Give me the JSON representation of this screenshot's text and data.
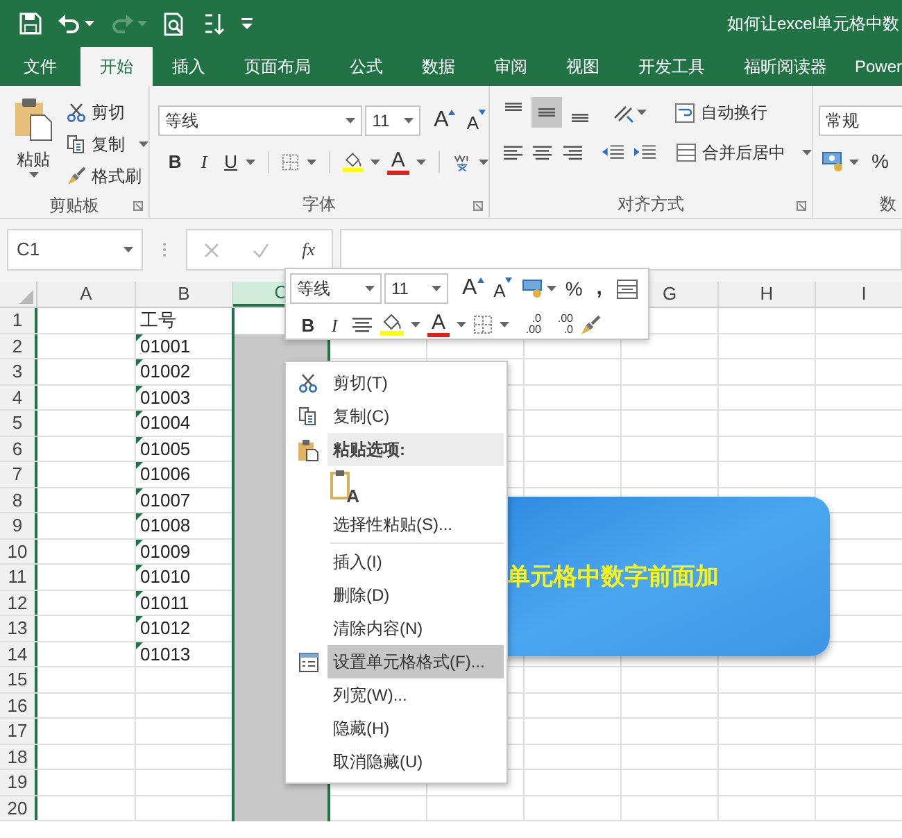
{
  "title_bar": {
    "title": "如何让excel单元格中数"
  },
  "tabs": [
    {
      "label": "文件",
      "selected": false
    },
    {
      "label": "开始",
      "selected": true
    },
    {
      "label": "插入",
      "selected": false
    },
    {
      "label": "页面布局",
      "selected": false
    },
    {
      "label": "公式",
      "selected": false
    },
    {
      "label": "数据",
      "selected": false
    },
    {
      "label": "审阅",
      "selected": false
    },
    {
      "label": "视图",
      "selected": false
    },
    {
      "label": "开发工具",
      "selected": false
    },
    {
      "label": "福昕阅读器",
      "selected": false
    },
    {
      "label": "Power",
      "selected": false
    }
  ],
  "ribbon": {
    "clipboard": {
      "label": "剪贴板",
      "paste": "粘贴",
      "items": [
        {
          "label": "剪切",
          "kind": "cut"
        },
        {
          "label": "复制",
          "kind": "copy"
        },
        {
          "label": "格式刷",
          "kind": "brush"
        }
      ]
    },
    "font": {
      "label": "字体",
      "font_name": "等线",
      "font_size": "11",
      "grow": "A",
      "shrink": "A",
      "bold": "B",
      "italic": "I",
      "underline": "U",
      "font_color": "A"
    },
    "alignment": {
      "label": "对齐方式",
      "vertical_align": [
        {
          "selected": false
        },
        {
          "selected": true
        },
        {
          "selected": false
        }
      ],
      "wrap_text": "自动换行",
      "merge_center": "合并后居中"
    },
    "number": {
      "label": "数",
      "format": "常规",
      "percent": "%"
    }
  },
  "formula_bar": {
    "name_box": "C1",
    "function_label": "fx"
  },
  "sheet": {
    "columns": [
      {
        "label": "A",
        "selected": false
      },
      {
        "label": "B",
        "selected": false
      },
      {
        "label": "C",
        "selected": true
      },
      {
        "label": "G",
        "selected": false
      },
      {
        "label": "H",
        "selected": false
      },
      {
        "label": "I",
        "selected": false
      }
    ],
    "rows": [
      {
        "header": "1",
        "b": {
          "text": "工号",
          "flag": false
        }
      },
      {
        "header": "2",
        "b": {
          "text": "01001",
          "flag": true
        }
      },
      {
        "header": "3",
        "b": {
          "text": "01002",
          "flag": true
        }
      },
      {
        "header": "4",
        "b": {
          "text": "01003",
          "flag": true
        }
      },
      {
        "header": "5",
        "b": {
          "text": "01004",
          "flag": true
        }
      },
      {
        "header": "6",
        "b": {
          "text": "01005",
          "flag": true
        }
      },
      {
        "header": "7",
        "b": {
          "text": "01006",
          "flag": true
        }
      },
      {
        "header": "8",
        "b": {
          "text": "01007",
          "flag": true
        }
      },
      {
        "header": "9",
        "b": {
          "text": "01008",
          "flag": true
        }
      },
      {
        "header": "10",
        "b": {
          "text": "01009",
          "flag": true
        }
      },
      {
        "header": "11",
        "b": {
          "text": "01010",
          "flag": true
        }
      },
      {
        "header": "12",
        "b": {
          "text": "01011",
          "flag": true
        }
      },
      {
        "header": "13",
        "b": {
          "text": "01012",
          "flag": true
        }
      },
      {
        "header": "14",
        "b": {
          "text": "01013",
          "flag": true
        }
      },
      {
        "header": "15"
      },
      {
        "header": "16"
      },
      {
        "header": "17"
      },
      {
        "header": "18"
      },
      {
        "header": "19"
      },
      {
        "header": "20"
      }
    ]
  },
  "mini_toolbar": {
    "font_name": "等线",
    "font_size": "11",
    "grow": "A",
    "shrink": "A",
    "percent": "%",
    "comma": ",",
    "bold": "B",
    "italic": "I",
    "font_color": "A",
    "increase_decimal": {
      "top": ".0",
      "bottom": ".00"
    },
    "decrease_decimal": {
      "top": ".00",
      "bottom": ".0"
    }
  },
  "context_menu": {
    "items": [
      {
        "kind": "cut",
        "label": "剪切(T)",
        "selected": false
      },
      {
        "kind": "copy",
        "label": "复制(C)",
        "selected": false
      },
      {
        "kind": "header",
        "label": "粘贴选项:",
        "selected": false
      },
      {
        "kind": "paste_option",
        "glyph": "A",
        "selected": false
      },
      {
        "kind": "item",
        "label": "选择性粘贴(S)...",
        "selected": false
      },
      {
        "kind": "separator"
      },
      {
        "kind": "item",
        "label": "插入(I)",
        "selected": false
      },
      {
        "kind": "item",
        "label": "删除(D)",
        "selected": false
      },
      {
        "kind": "item",
        "label": "清除内容(N)",
        "selected": false
      },
      {
        "kind": "format",
        "label": "设置单元格格式(F)...",
        "selected": true
      },
      {
        "kind": "item",
        "label": "列宽(W)...",
        "selected": false
      },
      {
        "kind": "item",
        "label": "隐藏(H)",
        "selected": false
      },
      {
        "kind": "item",
        "label": "取消隐藏(U)",
        "selected": false
      }
    ]
  },
  "banner": {
    "text": "单元格中数字前面加"
  }
}
